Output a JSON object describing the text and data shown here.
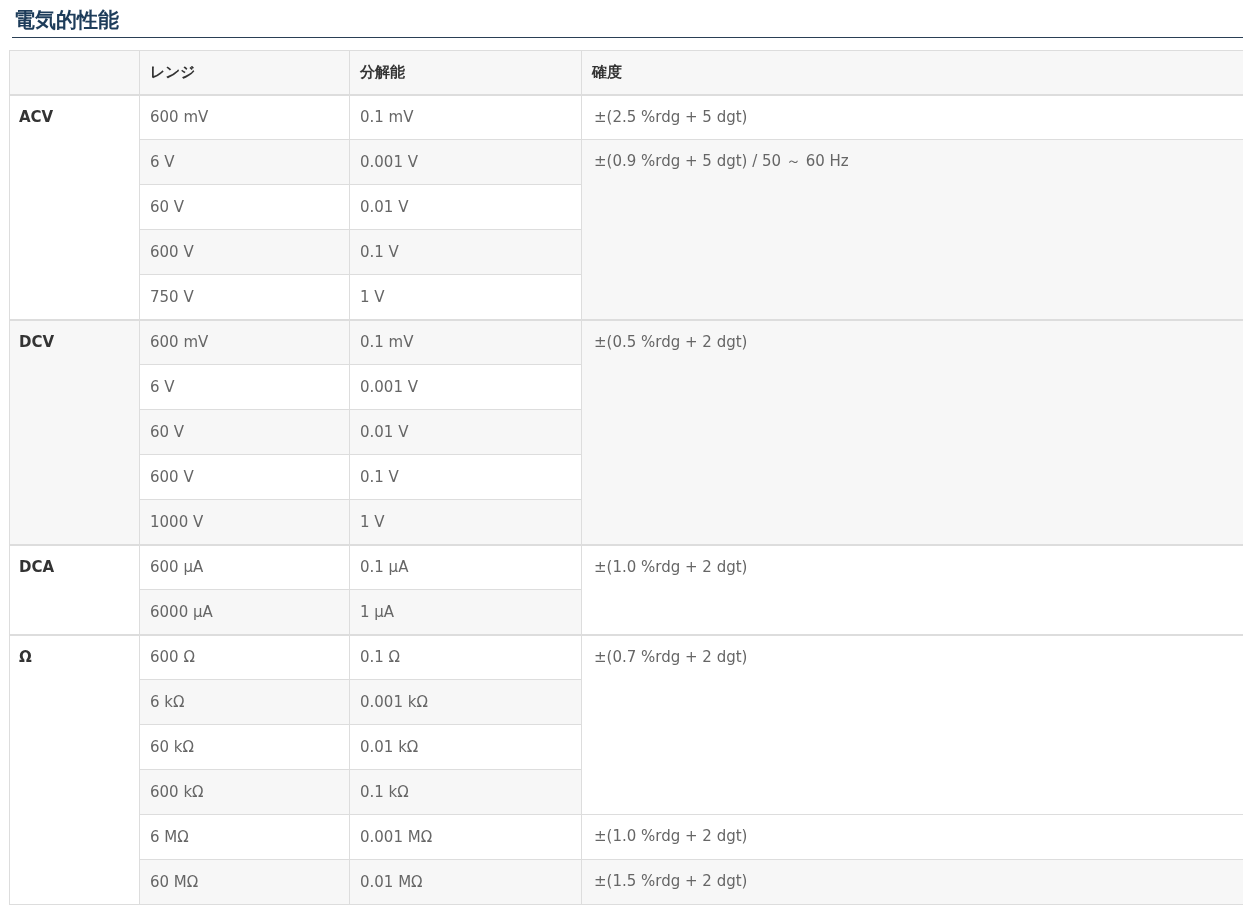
{
  "title": "電気的性能",
  "table": {
    "columns": [
      "",
      "レンジ",
      "分解能",
      "確度"
    ],
    "groups": [
      {
        "label": "ACV",
        "rows": [
          {
            "range": "600 mV",
            "resolution": "0.1 mV",
            "accuracy": "±(2.5 %rdg + 5 dgt)"
          },
          {
            "range": "6 V",
            "resolution": "0.001 V",
            "accuracy": "±(0.9 %rdg + 5 dgt) / 50 ～ 60 Hz"
          },
          {
            "range": "60 V",
            "resolution": "0.01 V"
          },
          {
            "range": "600 V",
            "resolution": "0.1 V"
          },
          {
            "range": "750 V",
            "resolution": "1 V"
          }
        ]
      },
      {
        "label": "DCV",
        "rows": [
          {
            "range": "600 mV",
            "resolution": "0.1 mV",
            "accuracy": "±(0.5 %rdg + 2 dgt)"
          },
          {
            "range": "6 V",
            "resolution": "0.001 V"
          },
          {
            "range": "60 V",
            "resolution": "0.01 V"
          },
          {
            "range": "600 V",
            "resolution": "0.1 V"
          },
          {
            "range": "1000 V",
            "resolution": "1 V"
          }
        ]
      },
      {
        "label": "DCA",
        "rows": [
          {
            "range": "600 μA",
            "resolution": "0.1 μA",
            "accuracy": "±(1.0 %rdg + 2 dgt)"
          },
          {
            "range": "6000 μA",
            "resolution": "1 μA"
          }
        ]
      },
      {
        "label": "Ω",
        "rows": [
          {
            "range": "600 Ω",
            "resolution": "0.1 Ω",
            "accuracy": "±(0.7 %rdg + 2 dgt)"
          },
          {
            "range": "6 kΩ",
            "resolution": "0.001 kΩ"
          },
          {
            "range": "60 kΩ",
            "resolution": "0.01 kΩ"
          },
          {
            "range": "600 kΩ",
            "resolution": "0.1 kΩ"
          },
          {
            "range": "6 MΩ",
            "resolution": "0.001 MΩ",
            "accuracy": "±(1.0 %rdg + 2 dgt)"
          },
          {
            "range": "60 MΩ",
            "resolution": "0.01 MΩ",
            "accuracy": "±(1.5 %rdg + 2 dgt)"
          }
        ]
      }
    ]
  }
}
